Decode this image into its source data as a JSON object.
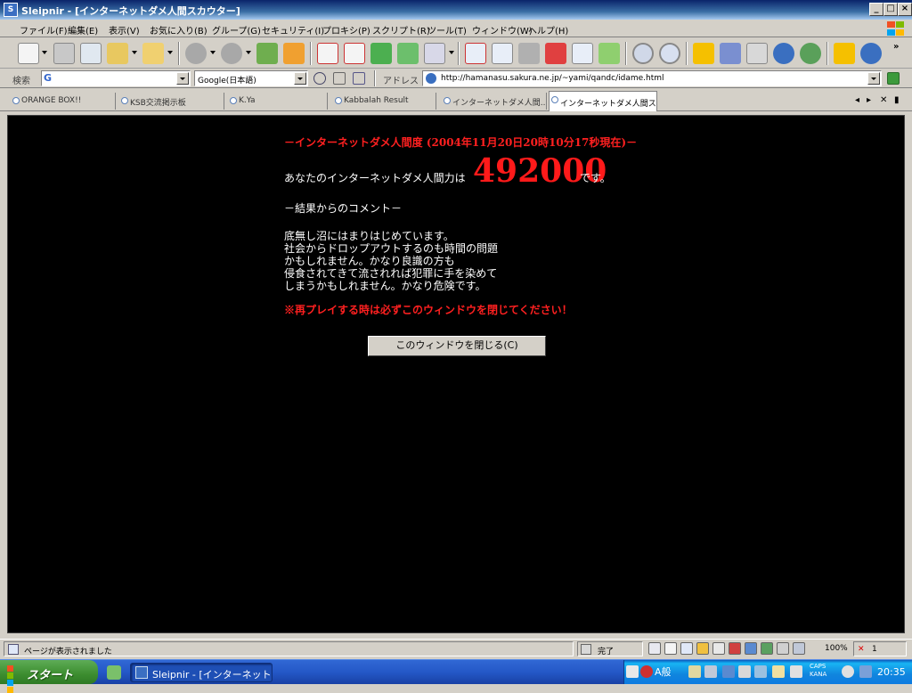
{
  "window": {
    "title": "Sleipnir - [インターネットダメ人間スカウター]"
  },
  "menu": [
    "ファイル(F)",
    "編集(E)",
    "表示(V)",
    "お気に入り(B)",
    "グループ(G)",
    "セキュリティ(I)",
    "プロキシ(P)",
    "スクリプト(R)",
    "ツール(T)",
    "ウィンドウ(W)",
    "ヘルプ(H)"
  ],
  "search": {
    "label": "検索",
    "engine": "Google(日本語)"
  },
  "address": {
    "label": "アドレス",
    "url": "http://hamanasu.sakura.ne.jp/~yami/qandc/idame.html"
  },
  "tabs": [
    "ORANGE BOX!!",
    "KSB交流掲示板",
    "K.Ya",
    "Kabbalah Result",
    "インターネットダメ人間...",
    "インターネットダメ人間ス..."
  ],
  "content": {
    "heading": "－インターネットダメ人間度 (2004年11月20日20時10分17秒現在)－",
    "score_prefix": "あなたのインターネットダメ人間力は",
    "score": "492000",
    "score_suffix": "です。",
    "comment_heading": "－結果からのコメント－",
    "comment_lines": [
      "底無し沼にはまりはじめています。",
      "社会からドロップアウトするのも時間の問題",
      "かもしれません。かなり良識の方も",
      "侵食されてきて流されれば犯罪に手を染めて",
      "しまうかもしれません。かなり危険です。"
    ],
    "warning": "※再プレイする時は必ずこのウィンドウを閉じてください！",
    "close_button": "このウィンドウを閉じる(C)"
  },
  "status": {
    "message": "ページが表示されました",
    "state": "完了",
    "zoom": "100%",
    "errors": "1"
  },
  "taskbar": {
    "start": "スタート",
    "task": "Sleipnir - [インターネット...",
    "ime": "A般",
    "caps": "CAPS",
    "kana": "KANA",
    "clock": "20:35"
  },
  "colors": {
    "score_red": "#ff1a1a",
    "heading_red": "#ff2020",
    "page_bg": "#000000"
  }
}
